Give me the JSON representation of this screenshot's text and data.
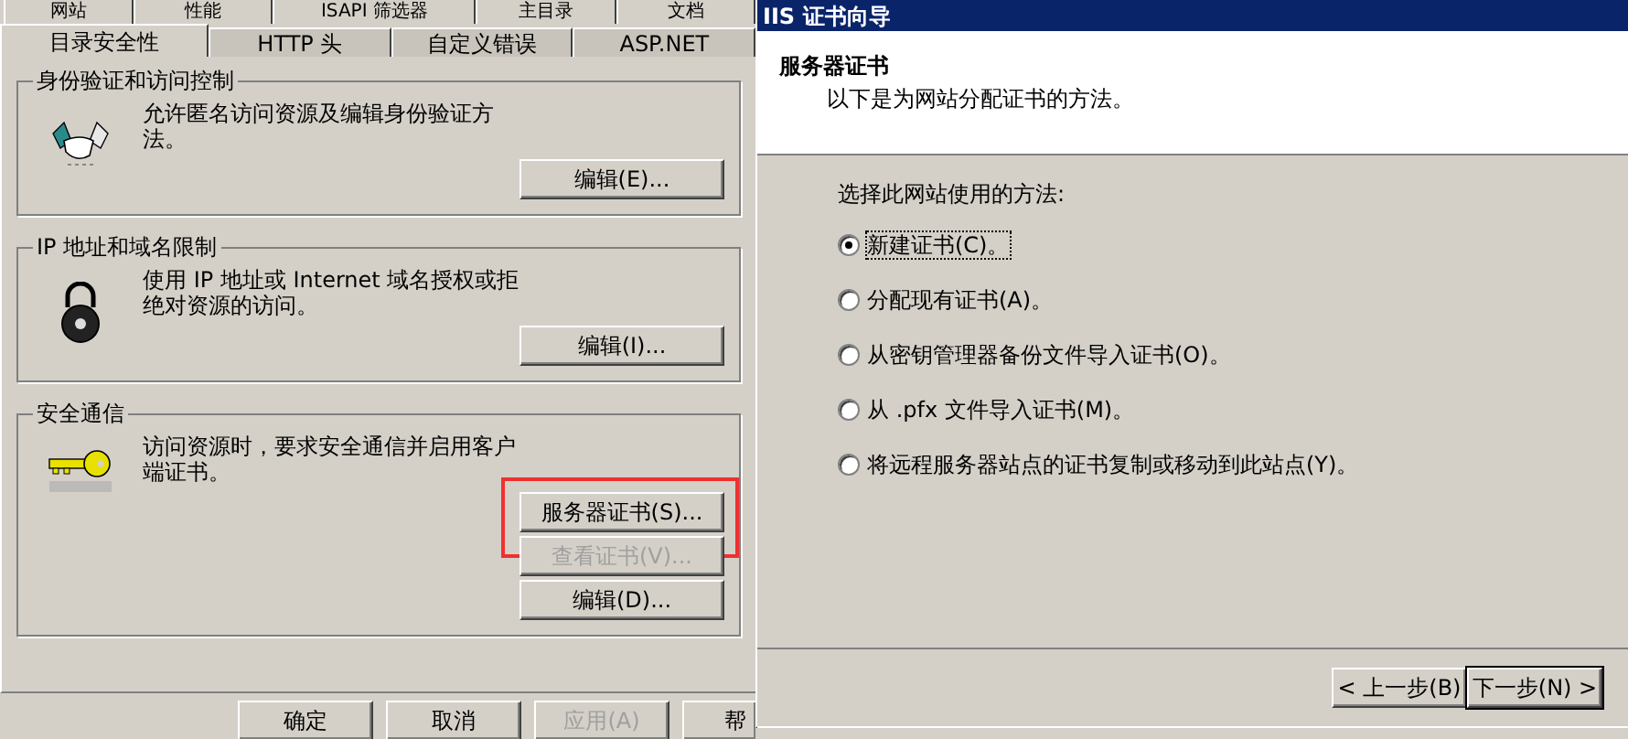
{
  "properties_dialog": {
    "tabs_back_row": [
      {
        "label": "网站",
        "selected": false
      },
      {
        "label": "性能",
        "selected": false
      },
      {
        "label": "ISAPI 筛选器",
        "selected": false
      },
      {
        "label": "主目录",
        "selected": false
      },
      {
        "label": "文档",
        "selected": false
      }
    ],
    "tabs_front_row": [
      {
        "label": "目录安全性",
        "selected": true
      },
      {
        "label": "HTTP 头",
        "selected": false
      },
      {
        "label": "自定义错误",
        "selected": false
      },
      {
        "label": "ASP.NET",
        "selected": false
      }
    ],
    "groups": [
      {
        "kind": "auth",
        "title": "身份验证和访问控制",
        "description": "允许匿名访问资源及编辑身份验证方法。",
        "buttons": [
          {
            "label": "编辑(E)...",
            "disabled": false,
            "highlighted": false
          }
        ]
      },
      {
        "kind": "ip",
        "title": "IP 地址和域名限制",
        "description": "使用 IP 地址或 Internet 域名授权或拒绝对资源的访问。",
        "buttons": [
          {
            "label": "编辑(I)...",
            "disabled": false,
            "highlighted": false
          }
        ]
      },
      {
        "kind": "secure",
        "title": "安全通信",
        "description": "访问资源时，要求安全通信并启用客户端证书。",
        "buttons": [
          {
            "label": "服务器证书(S)...",
            "disabled": false,
            "highlighted": true
          },
          {
            "label": "查看证书(V)...",
            "disabled": true,
            "highlighted": false
          },
          {
            "label": "编辑(D)...",
            "disabled": false,
            "highlighted": false
          }
        ]
      }
    ],
    "buttons": [
      {
        "label": "确定",
        "disabled": false
      },
      {
        "label": "取消",
        "disabled": false
      },
      {
        "label": "应用(A)",
        "disabled": true
      },
      {
        "label": "帮",
        "disabled": false
      }
    ]
  },
  "wizard": {
    "title": "IIS 证书向导",
    "heading": "服务器证书",
    "subheading": "以下是为网站分配证书的方法。",
    "prompt": "选择此网站使用的方法:",
    "options": [
      {
        "label": "新建证书(C)。",
        "selected": true
      },
      {
        "label": "分配现有证书(A)。",
        "selected": false
      },
      {
        "label": "从密钥管理器备份文件导入证书(O)。",
        "selected": false
      },
      {
        "label": "从 .pfx 文件导入证书(M)。",
        "selected": false
      },
      {
        "label": "将远程服务器站点的证书复制或移动到此站点(Y)。",
        "selected": false
      }
    ],
    "buttons": [
      {
        "label": "< 上一步(B)",
        "default": false
      },
      {
        "label": "下一步(N) >",
        "default": true
      }
    ]
  }
}
